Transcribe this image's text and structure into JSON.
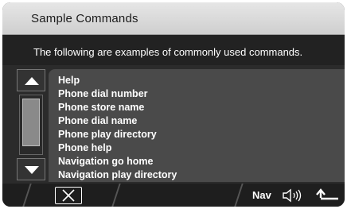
{
  "header": {
    "title": "Sample Commands"
  },
  "intro": {
    "text": "The following are examples of commonly used commands."
  },
  "commands": [
    "Help",
    "Phone dial number",
    "Phone store name",
    "Phone dial name",
    "Phone play directory",
    "Phone help",
    "Navigation go home",
    "Navigation play directory"
  ],
  "scrollbar": {
    "position": 0.0
  },
  "footer": {
    "close_icon": "close-x-icon",
    "nav_label": "Nav",
    "speaker_icon": "speaker-icon",
    "back_icon": "return-arrow-icon"
  }
}
